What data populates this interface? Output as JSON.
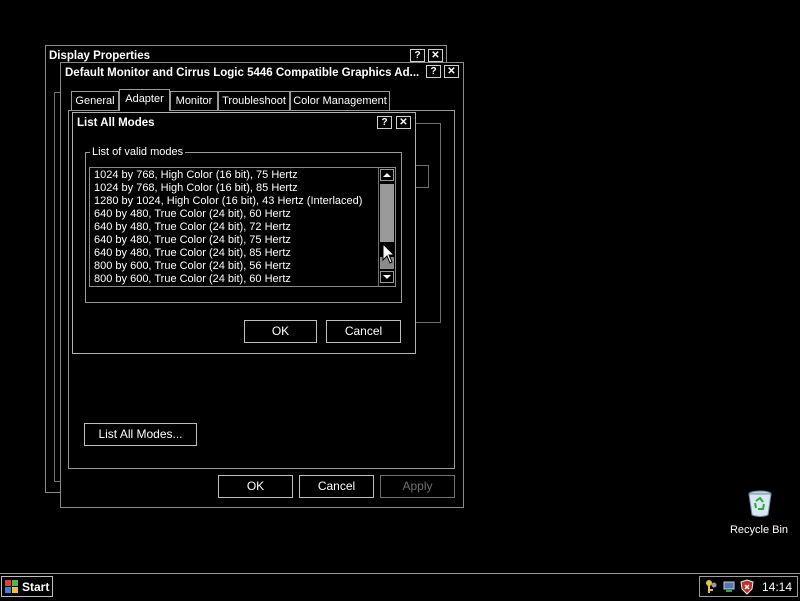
{
  "display_window": {
    "title": "Display Properties"
  },
  "monitor_window": {
    "title": "Default Monitor and Cirrus Logic 5446 Compatible Graphics Ad...",
    "tabs": [
      {
        "label": "General"
      },
      {
        "label": "Adapter"
      },
      {
        "label": "Monitor"
      },
      {
        "label": "Troubleshoot"
      },
      {
        "label": "Color Management"
      }
    ],
    "list_all_modes_button": "List All Modes...",
    "ok_label": "OK",
    "cancel_label": "Cancel",
    "apply_label": "Apply"
  },
  "modes_dialog": {
    "title": "List All Modes",
    "group_label": "List of valid modes",
    "modes": [
      "1024 by 768, High Color (16 bit), 75 Hertz",
      "1024 by 768, High Color (16 bit), 85 Hertz",
      "1280 by 1024, High Color (16 bit), 43 Hertz (Interlaced)",
      "640 by 480, True Color (24 bit), 60 Hertz",
      "640 by 480, True Color (24 bit), 72 Hertz",
      "640 by 480, True Color (24 bit), 75 Hertz",
      "640 by 480, True Color (24 bit), 85 Hertz",
      "800 by 600, True Color (24 bit), 56 Hertz",
      "800 by 600, True Color (24 bit), 60 Hertz"
    ],
    "ok_label": "OK",
    "cancel_label": "Cancel"
  },
  "title_buttons": {
    "help": "?",
    "close": "✕"
  },
  "desktop": {
    "recycle_bin_label": "Recycle Bin"
  },
  "taskbar": {
    "start_label": "Start",
    "clock": "14:14"
  },
  "colors": {
    "background": "#000000",
    "text": "#ffffff",
    "border": "#8a8a8a"
  }
}
